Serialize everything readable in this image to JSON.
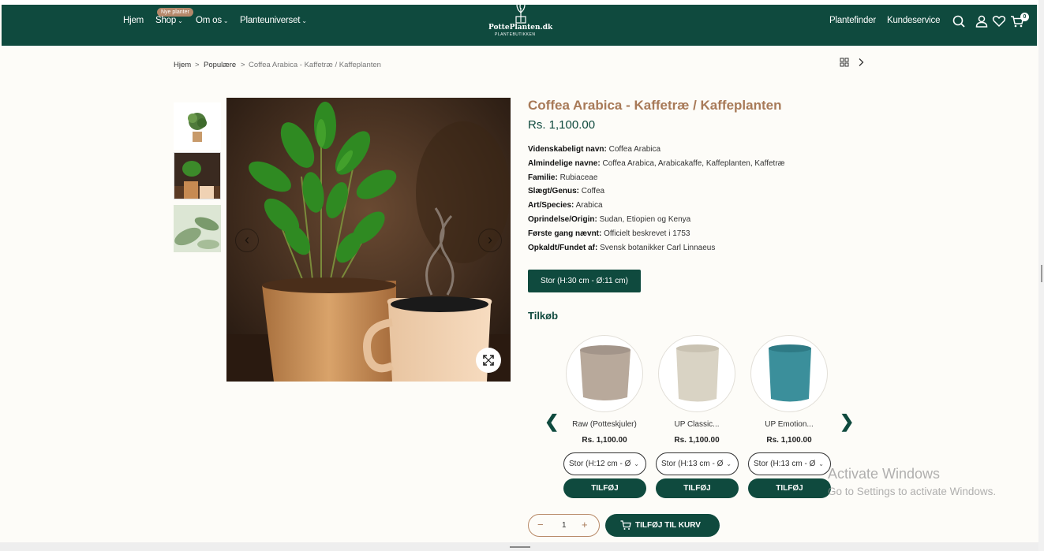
{
  "header": {
    "nav": [
      {
        "label": "Hjem",
        "has_dropdown": false
      },
      {
        "label": "Shop",
        "has_dropdown": true,
        "badge": "Nye planter"
      },
      {
        "label": "Om os",
        "has_dropdown": true
      },
      {
        "label": "Planteuniverset",
        "has_dropdown": true
      }
    ],
    "logo_text": "PottePlanten.dk",
    "logo_sub": "PLANTEBUTIKKEN",
    "right_links": [
      "Plantefinder",
      "Kundeservice"
    ],
    "icons": [
      "search-icon",
      "user-icon",
      "heart-icon",
      "cart-icon"
    ],
    "cart_count": "0",
    "bg_color": "#0f4a3e"
  },
  "breadcrumb": {
    "items": [
      "Hjem",
      "Populære",
      "Coffea Arabica - Kaffetræ / Kaffeplanten"
    ],
    "separator": ">"
  },
  "product": {
    "title": "Coffea Arabica - Kaffetræ / Kaffeplanten",
    "price": "Rs. 1,100.00",
    "attributes": [
      {
        "key": "Videnskabeligt navn:",
        "value": "Coffea Arabica"
      },
      {
        "key": "Almindelige navne:",
        "value": "Coffea Arabica, Arabicakaffe, Kaffeplanten, Kaffetræ"
      },
      {
        "key": "Familie:",
        "value": "Rubiaceae"
      },
      {
        "key": "Slægt/Genus:",
        "value": "Coffea"
      },
      {
        "key": "Art/Species:",
        "value": "Arabica"
      },
      {
        "key": "Oprindelse/Origin:",
        "value": "Sudan, Etiopien og Kenya"
      },
      {
        "key": "Første gang nævnt:",
        "value": "Officielt beskrevet i 1753"
      },
      {
        "key": "Opkaldt/Fundet af:",
        "value": "Svensk botanikker Carl Linnaeus"
      }
    ],
    "size_option": "Stor (H:30 cm - Ø:11 cm)",
    "title_color": "#a87a58"
  },
  "addons": {
    "title": "Tilkøb",
    "items": [
      {
        "name": "Raw (Potteskjuler)",
        "price": "Rs. 1,100.00",
        "size": "Stor (H:12 cm - Ø",
        "button": "TILFØJ",
        "color": "#b8a99b"
      },
      {
        "name": "UP Classic...",
        "price": "Rs. 1,100.00",
        "size": "Stor (H:13 cm - Ø",
        "button": "TILFØJ",
        "color": "#d9d3c4"
      },
      {
        "name": "UP Emotion...",
        "price": "Rs. 1,100.00",
        "size": "Stor (H:13 cm - Ø",
        "button": "TILFØJ",
        "color": "#3b8f9b"
      }
    ]
  },
  "cart": {
    "quantity": "1",
    "minus": "−",
    "plus": "+",
    "add_label": "TILFØJ TIL KURV"
  },
  "watermark": {
    "line1": "Activate Windows",
    "line2": "Go to Settings to activate Windows."
  }
}
